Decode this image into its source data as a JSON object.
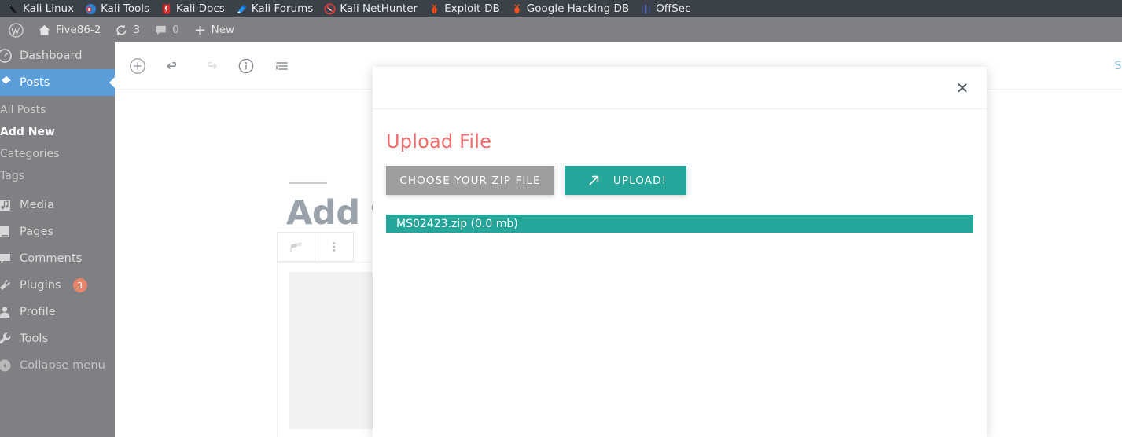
{
  "browser": {
    "bookmarks": [
      {
        "label": "Kali Linux",
        "icon": "kali-dragon-icon"
      },
      {
        "label": "Kali Tools",
        "icon": "kali-tools-icon"
      },
      {
        "label": "Kali Docs",
        "icon": "kali-docs-book-icon"
      },
      {
        "label": "Kali Forums",
        "icon": "kali-forums-icon"
      },
      {
        "label": "Kali NetHunter",
        "icon": "kali-nethunter-icon"
      },
      {
        "label": "Exploit-DB",
        "icon": "exploit-db-bug-icon"
      },
      {
        "label": "Google Hacking DB",
        "icon": "google-hacking-db-bug-icon"
      },
      {
        "label": "OffSec",
        "icon": "offsec-icon"
      }
    ]
  },
  "adminbar": {
    "logo_icon": "wordpress-logo-icon",
    "site_name": "Five86-2",
    "site_icon": "home-icon",
    "updates_icon": "updates-icon",
    "updates_count": "3",
    "comments_icon": "comment-bubble-icon",
    "comments_count": "0",
    "new_icon": "plus-icon",
    "new_label": "New"
  },
  "sidebar": {
    "items": [
      {
        "label": "Dashboard",
        "icon": "dashboard-icon",
        "current": false
      },
      {
        "label": "Posts",
        "icon": "pin-icon",
        "current": true
      },
      {
        "label": "Media",
        "icon": "media-icon",
        "current": false
      },
      {
        "label": "Pages",
        "icon": "pages-icon",
        "current": false
      },
      {
        "label": "Comments",
        "icon": "comments-icon",
        "current": false
      },
      {
        "label": "Plugins",
        "icon": "plugins-icon",
        "current": false,
        "badge": "3"
      },
      {
        "label": "Profile",
        "icon": "profile-icon",
        "current": false
      },
      {
        "label": "Tools",
        "icon": "tools-icon",
        "current": false
      },
      {
        "label": "Collapse menu",
        "icon": "collapse-icon",
        "current": false
      }
    ],
    "posts_submenu": [
      {
        "label": "All Posts",
        "active": false
      },
      {
        "label": "Add New",
        "active": true
      },
      {
        "label": "Categories",
        "active": false
      },
      {
        "label": "Tags",
        "active": false
      }
    ]
  },
  "editor": {
    "toolbar": [
      {
        "name": "add-block-button",
        "icon": "circle-plus-icon",
        "disabled": false
      },
      {
        "name": "undo-button",
        "icon": "undo-icon",
        "disabled": false
      },
      {
        "name": "redo-button",
        "icon": "redo-icon",
        "disabled": true
      },
      {
        "name": "details-button",
        "icon": "info-circle-icon",
        "disabled": false
      },
      {
        "name": "list-view-button",
        "icon": "list-view-icon",
        "disabled": false
      }
    ],
    "save_draft_label": "Sa",
    "post_title_placeholder": "Add t",
    "block_toolbar": [
      {
        "name": "block-type-button",
        "icon": "paragraph-block-icon"
      },
      {
        "name": "block-options-button",
        "icon": "vertical-dots-icon"
      }
    ]
  },
  "modal": {
    "close_icon": "close-x-icon",
    "title": "Upload File",
    "choose_button_label": "CHOOSE YOUR ZIP FILE",
    "upload_button_label": "UPLOAD!",
    "upload_button_icon": "arrow-up-right-icon",
    "uploaded_file": "MS02423.zip (0.0 mb)"
  },
  "colors": {
    "teal": "#26a69a",
    "coral": "#ef6b6b",
    "grey_button": "#9e9e9e",
    "sidebar": "#7f8083",
    "current_menu": "#5b9dd9",
    "badge": "#e8866b"
  }
}
